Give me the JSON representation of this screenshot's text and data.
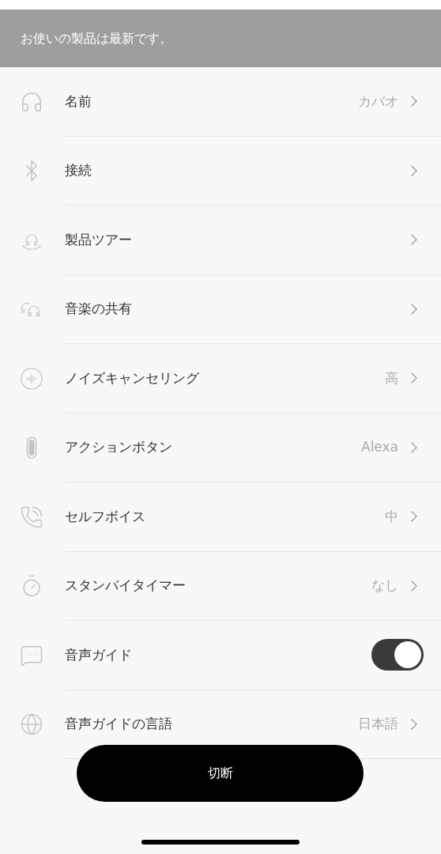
{
  "banner": "お使いの製品は最新です。",
  "items": [
    {
      "kind": "link",
      "label": "名前",
      "value": "カバオ"
    },
    {
      "kind": "link",
      "label": "接続"
    },
    {
      "kind": "link",
      "label": "製品ツアー"
    },
    {
      "kind": "link",
      "label": "音楽の共有"
    },
    {
      "kind": "link",
      "label": "ノイズキャンセリング",
      "value": "高"
    },
    {
      "kind": "link",
      "label": "アクションボタン",
      "value": "Alexa"
    },
    {
      "kind": "link",
      "label": "セルフボイス",
      "value": "中"
    },
    {
      "kind": "link",
      "label": "スタンバイタイマー",
      "value": "なし"
    },
    {
      "kind": "toggle",
      "label": "音声ガイド",
      "on": true
    },
    {
      "kind": "link",
      "label": "音声ガイドの言語",
      "value": "日本語"
    }
  ],
  "button": "切断"
}
